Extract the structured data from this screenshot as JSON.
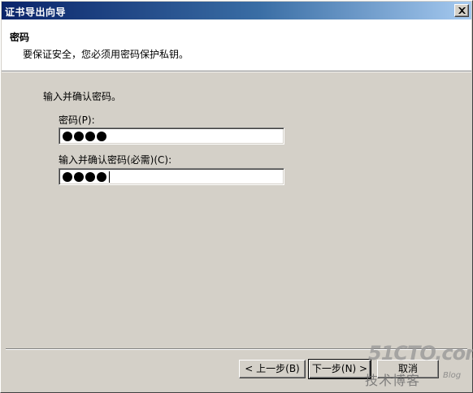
{
  "window": {
    "title": "证书导出向导"
  },
  "header": {
    "title": "密码",
    "subtitle": "要保证安全，您必须用密码保护私钥。"
  },
  "form": {
    "instruction": "输入并确认密码。",
    "password_label": "密码(P):",
    "password_masked_count": 4,
    "confirm_label": "输入并确认密码(必需)(C):",
    "confirm_masked_count": 4
  },
  "buttons": {
    "back": "< 上一步(B)",
    "next": "下一步(N) >",
    "cancel": "取消"
  },
  "watermark": {
    "main": "51CTO.com",
    "sub": "技术博客",
    "blog": "Blog"
  },
  "colors": {
    "dialog_bg": "#d4d0c8",
    "title_gradient_start": "#0a246a",
    "title_gradient_end": "#a6caf0"
  }
}
